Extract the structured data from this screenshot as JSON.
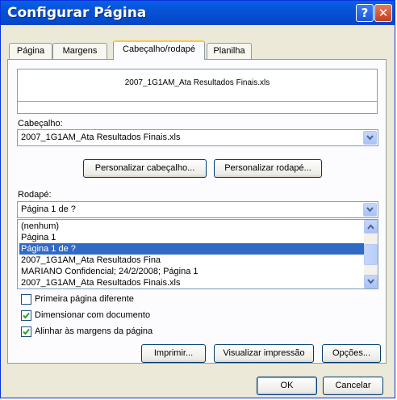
{
  "window": {
    "title": "Configurar Página"
  },
  "tabs": [
    {
      "label": "Página"
    },
    {
      "label": "Margens"
    },
    {
      "label": "Cabeçalho/rodapé"
    },
    {
      "label": "Planilha"
    }
  ],
  "preview": {
    "header_text": "2007_1G1AM_Ata Resultados Finais.xls"
  },
  "header_section": {
    "label": "Cabeçalho:",
    "selected_value": "2007_1G1AM_Ata Resultados Finais.xls"
  },
  "buttons": {
    "custom_header": "Personalizar cabeçalho...",
    "custom_footer": "Personalizar rodapé...",
    "print": "Imprimir...",
    "print_preview": "Visualizar impressão",
    "options": "Opções...",
    "ok": "OK",
    "cancel": "Cancelar"
  },
  "footer_section": {
    "label": "Rodapé:",
    "selected_value": "Página 1 de ?",
    "options": [
      "(nenhum)",
      "Página 1",
      "Página 1 de ?",
      "2007_1G1AM_Ata Resultados Fina",
      "MARIANO Confidencial; 24/2/2008; Página 1",
      "2007_1G1AM_Ata Resultados Finais.xls"
    ],
    "highlighted_index": 2
  },
  "checkboxes": [
    {
      "label": "Primeira página diferente",
      "checked": false
    },
    {
      "label": "Dimensionar com documento",
      "checked": true
    },
    {
      "label": "Alinhar às margens da página",
      "checked": true
    }
  ],
  "colors": {
    "titlebar": "#0553d6",
    "selection": "#316ac5",
    "dialog_bg": "#ece9d8"
  }
}
